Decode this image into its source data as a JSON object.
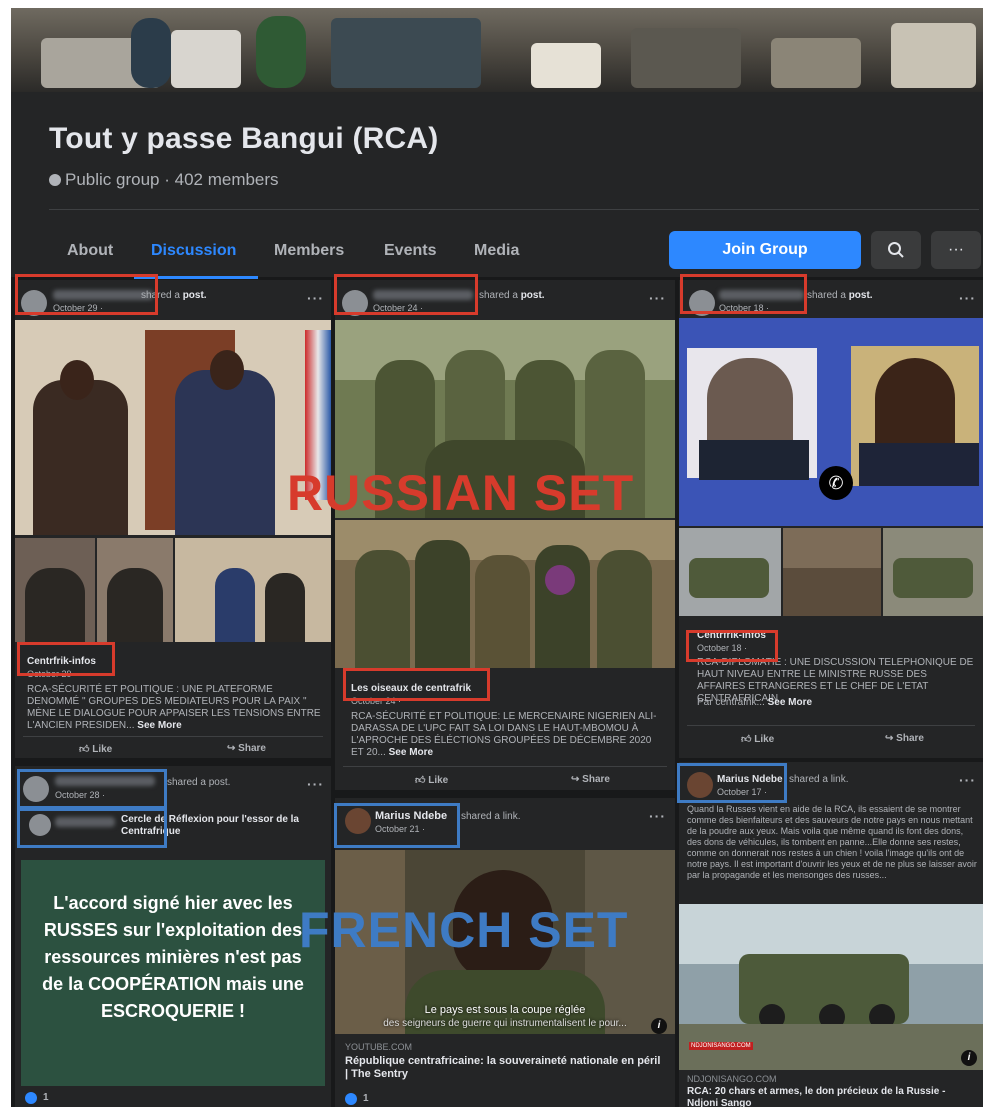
{
  "group": {
    "title": "Tout y passe Bangui (RCA)",
    "meta": "Public group · 402 members"
  },
  "tabs": [
    {
      "label": "About"
    },
    {
      "label": "Discussion"
    },
    {
      "label": "Members"
    },
    {
      "label": "Events"
    },
    {
      "label": "Media"
    }
  ],
  "buttons": {
    "join": "Join Group",
    "search_icon": "search-icon",
    "more_icon": "more-icon",
    "more_text": "···"
  },
  "overlays": {
    "russian": "RUSSIAN SET",
    "french": "FRENCH SET"
  },
  "posts": {
    "p1": {
      "shared": "shared a ",
      "shared_bold": "post.",
      "date": "October 29 · ",
      "page_name": "Centrfrik-infos",
      "page_date": "October 29 · ",
      "text": "RCA-SÉCURITÉ ET POLITIQUE  : UNE PLATEFORME DENOMMÉ \" GROUPES DES MEDIATEURS POUR LA PAIX \" MÈNE LE DIALOGUE POUR APPAISER LES TENSIONS ENTRE L'ANCIEN PRESIDEN...",
      "see_more": "See More",
      "like": "Like",
      "share": "Share"
    },
    "p2": {
      "shared": "shared a ",
      "shared_bold": "post.",
      "date": "October 24 · ",
      "page_name": "Les oiseaux de centrafrik",
      "page_date": "October 24 · ",
      "text": "RCA-SÉCURITÉ ET POLITIQUE: LE MERCENAIRE NIGERIEN ALI-DARASSA DE L'UPC FAIT SA LOI DANS LE HAUT-MBOMOU À L'APROCHE DES ÉLÉCTIONS GROUPÉES DE DÉCEMBRE 2020 ET 20...",
      "see_more": "See More",
      "like": "Like",
      "share": "Share"
    },
    "p3": {
      "shared": "shared a ",
      "shared_bold": "post.",
      "date": "October 18 · ",
      "page_name": "Centrfrik-infos",
      "page_date": "October 18 · ",
      "text": "RCA-DIPLOMATIE  : UNE DISCUSSION TELEPHONIQUE DE HAUT NIVEAU ENTRE LE MINISTRE RUSSE DES AFFAIRES ETRANGERES ET LE CHEF DE L'ETAT CENTRAFRICAIN",
      "by": "Par centrafrik...",
      "see_more": "See More",
      "like": "Like",
      "share": "Share"
    },
    "p4": {
      "shared": "shared a post.",
      "date": "October 28 · ",
      "page_name": "Cercle de Réflexion pour l'essor de la Centrafrique",
      "card_text": "L'accord signé hier avec les RUSSES sur l'exploitation des ressources minières n'est pas de la COOPÉRATION mais une ESCROQUERIE !",
      "reactions": "1"
    },
    "p5": {
      "author": "Marius Ndebe",
      "shared": "shared a link.",
      "date": "October 21 · ",
      "caption": "Le pays est sous la coupe réglée",
      "caption2": "des seigneurs de guerre qui instrumentalisent le pour...",
      "domain": "YOUTUBE.COM",
      "link_title": "République centrafricaine: la souveraineté nationale en péril | The Sentry",
      "reactions": "1"
    },
    "p6": {
      "author": "Marius Ndebe",
      "shared": "shared a link.",
      "date": "October 17 · ",
      "text": "Quand  la Russes vient en aide de la RCA, ils essaient de se montrer comme des  bienfaiteurs et des sauveurs de notre pays en nous  mettant de la  poudre aux yeux. Mais voila que même quand ils font des dons, des dons  de véhicules, ils tombent en panne...Elle donne ses restes, comme on donnerait nos restes à un chien ! voila l'image qu'ils ont de notre  pays.  Il est important d'ouvrir les yeux et de ne plus se laisser avoir  par la propagande et les mensonges des russes...",
      "watermark": "NDJONISANGO.COM",
      "domain": "NDJONISANGO.COM",
      "link_title": "RCA: 20 chars et armes, le don précieux de la Russie - Ndjoni Sango"
    }
  },
  "colors": {
    "russian_set": "#d73b2c",
    "french_set": "#3e7bc4",
    "accent": "#2d88ff"
  }
}
